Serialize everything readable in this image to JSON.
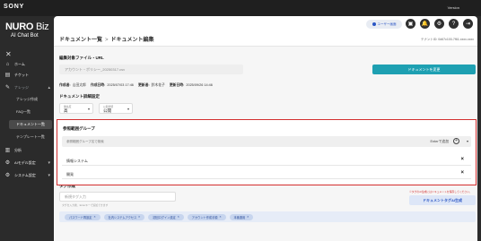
{
  "topbar": {
    "brand": "SONY",
    "version": "Version"
  },
  "sidebar": {
    "logo_main": "NURO",
    "logo_biz": " Biz",
    "logo_sub": "AI Chat Bot",
    "close": "✕",
    "items": [
      {
        "label": "ホーム",
        "icon": "home-icon",
        "glyph": "⌂"
      },
      {
        "label": "チケット",
        "icon": "ticket-icon",
        "glyph": "▤"
      },
      {
        "label": "ナレッジ",
        "icon": "knowledge-icon",
        "glyph": "✎",
        "arrow": "▴"
      },
      {
        "label": "ナレッジ作成",
        "sub": true
      },
      {
        "label": "FAQ一覧",
        "sub": true
      },
      {
        "label": "ドキュメント一覧",
        "sub": true,
        "active": true
      },
      {
        "label": "テンプレート一覧",
        "sub": true
      },
      {
        "label": "分析",
        "icon": "chart-icon",
        "glyph": "▥"
      },
      {
        "label": "AIモデル設定",
        "icon": "gear-icon",
        "glyph": "⚙",
        "arrow": "▾"
      },
      {
        "label": "システム設定",
        "icon": "settings-icon",
        "glyph": "⚙",
        "arrow": "▾"
      }
    ]
  },
  "header": {
    "breadcrumb_parent": "ドキュメント一覧",
    "breadcrumb_sep": ">",
    "breadcrumb_current": "ドキュメント編集",
    "user_button": "ユーザー画面",
    "icons": [
      "▣",
      "🔔",
      "⚙",
      "?",
      "⇥"
    ],
    "tenant": "テナントID: 0d67c100-7f61-xxxx-xxxx"
  },
  "doc": {
    "file_section": "編集対象ファイル・URL",
    "file_value": "アカウント・ポリシー_20250317.csv",
    "change_button": "ドキュメントを変更",
    "creator_label": "作成者:",
    "creator": "山田太郎",
    "created_label": "作成日時:",
    "created": "2025/07/03 17:46",
    "updater_label": "更新者:",
    "updater": "鈴木花子",
    "updated_label": "更新日時:",
    "updated": "2025/09/26 14:46",
    "detail_section": "ドキュメント詳細設定",
    "select1_label": "優先度",
    "select1_value": "高",
    "select2_label": "公開状態",
    "select2_value": "公開"
  },
  "ref": {
    "title": "参照範囲グループ",
    "placeholder": "参照範囲グループ名で検索",
    "hint": "Enterで追加",
    "groups": [
      "情報システム",
      "開発"
    ],
    "remove": "×"
  },
  "tags": {
    "title": "タグ作成",
    "input_placeholder": "新規タグ入力",
    "input_hint": "タグを入力後、Enterキーで追加できます",
    "ai_note": "※タグのAI生成にはドキュメントを保存してください。",
    "ai_button": "ドキュメントタグAI生成",
    "chips": [
      "パスワード再設定",
      "社内システムアクセス",
      "初回ログイン設定",
      "アカウント作成手順",
      "本番運用"
    ],
    "chip_remove": "×"
  }
}
